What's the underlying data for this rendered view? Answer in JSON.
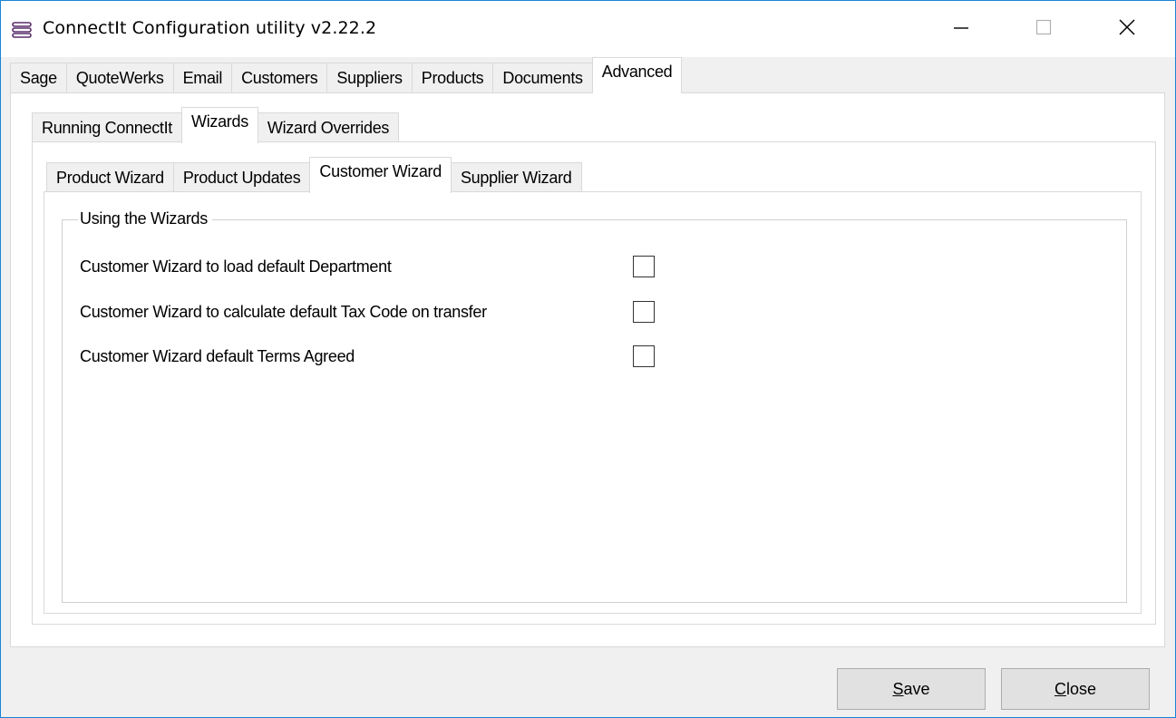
{
  "window": {
    "title": "ConnectIt Configuration utility v2.22.2",
    "accent_border": "#1883d7",
    "icons": [
      "app-stack-icon",
      "minimize-icon",
      "maximize-icon",
      "close-icon"
    ]
  },
  "main_tabs": [
    {
      "label": "Sage",
      "active": false
    },
    {
      "label": "QuoteWerks",
      "active": false
    },
    {
      "label": "Email",
      "active": false
    },
    {
      "label": "Customers",
      "active": false
    },
    {
      "label": "Suppliers",
      "active": false
    },
    {
      "label": "Products",
      "active": false
    },
    {
      "label": "Documents",
      "active": false
    },
    {
      "label": "Advanced",
      "active": true
    }
  ],
  "advanced_tabs": [
    {
      "label": "Running ConnectIt",
      "active": false
    },
    {
      "label": "Wizards",
      "active": true
    },
    {
      "label": "Wizard Overrides",
      "active": false
    }
  ],
  "wizard_tabs": [
    {
      "label": "Product Wizard",
      "active": false
    },
    {
      "label": "Product Updates",
      "active": false
    },
    {
      "label": "Customer Wizard",
      "active": true
    },
    {
      "label": "Supplier Wizard",
      "active": false
    }
  ],
  "group": {
    "title": "Using the Wizards",
    "options": [
      {
        "label": "Customer Wizard to load default Department",
        "checked": false
      },
      {
        "label": "Customer Wizard to calculate default Tax Code on transfer",
        "checked": false
      },
      {
        "label": "Customer Wizard default Terms Agreed",
        "checked": false
      }
    ]
  },
  "buttons": {
    "save": {
      "mnemonic": "S",
      "rest": "ave"
    },
    "close": {
      "mnemonic": "C",
      "rest": "lose"
    }
  }
}
